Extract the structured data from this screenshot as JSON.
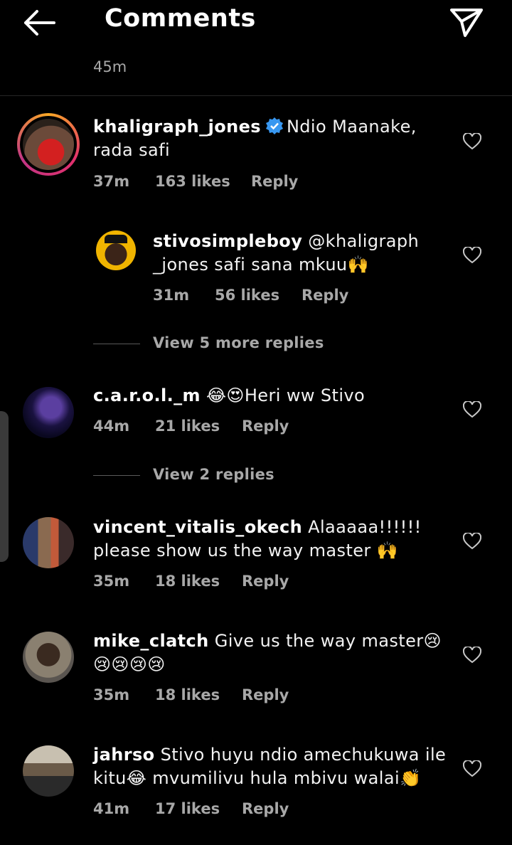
{
  "header": {
    "title": "Comments"
  },
  "top_time": "45m",
  "colors": {
    "background": "#000000",
    "muted": "#a8a8a8",
    "verified": "#3897f0",
    "story_ring": "#e1306c"
  },
  "comments": [
    {
      "username": "khaligraph_jones",
      "verified": true,
      "text_line1": "Ndio Maanake,",
      "text_line2": "rada safi",
      "time": "37m",
      "likes": "163 likes",
      "reply": "Reply"
    },
    {
      "username": "stivosimpleboy",
      "text_line1": "@khaligraph",
      "text_line2": "_jones safi sana mkuu🙌",
      "time": "31m",
      "likes": "56 likes",
      "reply": "Reply"
    },
    {
      "username": "c.a.r.o.l._m",
      "text_line1": "😂😍Heri ww Stivo",
      "time": "44m",
      "likes": "21 likes",
      "reply": "Reply"
    },
    {
      "username": "vincent_vitalis_okech",
      "text_line1": "Alaaaaa!!!!!!",
      "text_line2": "please show us the way master 🙌",
      "time": "35m",
      "likes": "18 likes",
      "reply": "Reply"
    },
    {
      "username": "mike_clatch",
      "text_line1": "Give us the way master😢",
      "text_line2": "😢😢😢😢",
      "time": "35m",
      "likes": "18 likes",
      "reply": "Reply"
    },
    {
      "username": "jahrso",
      "text_line1": "Stivo huyu ndio amechukuwa ile",
      "text_line2": "kitu😂 mvumilivu hula mbivu walai👏",
      "time": "41m",
      "likes": "17 likes",
      "reply": "Reply"
    }
  ],
  "view_more": [
    {
      "label": "View 5 more replies"
    },
    {
      "label": "View 2 replies"
    }
  ],
  "icons": [
    "back-arrow-icon",
    "send-icon",
    "heart-icon",
    "verified-badge-icon"
  ]
}
